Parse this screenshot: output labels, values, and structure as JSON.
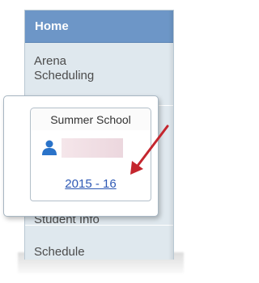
{
  "menu": {
    "home": "Home",
    "arena_line1": "Arena",
    "arena_line2": "Scheduling",
    "student_info": "Student Info",
    "schedule": "Schedule"
  },
  "popup": {
    "tab_title": "Summer School",
    "user_icon": "person-icon",
    "year_link": "2015 - 16"
  },
  "colors": {
    "header": "#6d96c7",
    "sidebar": "#dfe8ee",
    "link": "#2e59b5",
    "arrow": "#c4262e",
    "user_redacted": "#ecd7de"
  }
}
